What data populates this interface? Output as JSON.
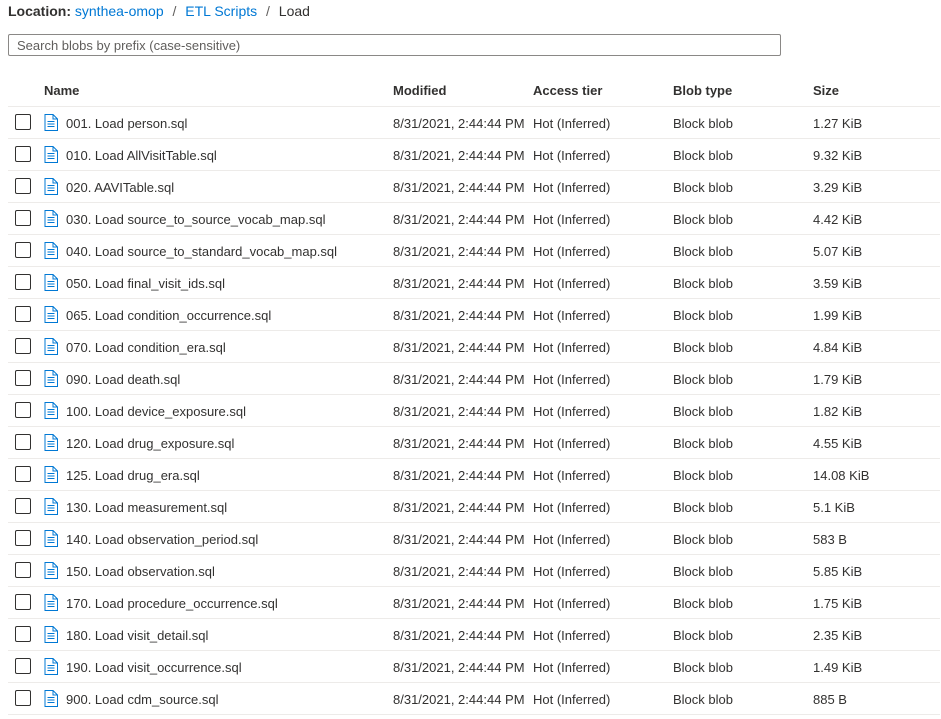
{
  "breadcrumb": {
    "label": "Location:",
    "items": [
      "synthea-omop",
      "ETL Scripts"
    ],
    "current": "Load"
  },
  "search": {
    "placeholder": "Search blobs by prefix (case-sensitive)",
    "value": ""
  },
  "table": {
    "columns": [
      "Name",
      "Modified",
      "Access tier",
      "Blob type",
      "Size"
    ],
    "rows": [
      {
        "name": "001. Load person.sql",
        "modified": "8/31/2021, 2:44:44 PM",
        "tier": "Hot (Inferred)",
        "type": "Block blob",
        "size": "1.27 KiB"
      },
      {
        "name": "010. Load AllVisitTable.sql",
        "modified": "8/31/2021, 2:44:44 PM",
        "tier": "Hot (Inferred)",
        "type": "Block blob",
        "size": "9.32 KiB"
      },
      {
        "name": "020. AAVITable.sql",
        "modified": "8/31/2021, 2:44:44 PM",
        "tier": "Hot (Inferred)",
        "type": "Block blob",
        "size": "3.29 KiB"
      },
      {
        "name": "030. Load source_to_source_vocab_map.sql",
        "modified": "8/31/2021, 2:44:44 PM",
        "tier": "Hot (Inferred)",
        "type": "Block blob",
        "size": "4.42 KiB"
      },
      {
        "name": "040. Load source_to_standard_vocab_map.sql",
        "modified": "8/31/2021, 2:44:44 PM",
        "tier": "Hot (Inferred)",
        "type": "Block blob",
        "size": "5.07 KiB"
      },
      {
        "name": "050. Load final_visit_ids.sql",
        "modified": "8/31/2021, 2:44:44 PM",
        "tier": "Hot (Inferred)",
        "type": "Block blob",
        "size": "3.59 KiB"
      },
      {
        "name": "065. Load condition_occurrence.sql",
        "modified": "8/31/2021, 2:44:44 PM",
        "tier": "Hot (Inferred)",
        "type": "Block blob",
        "size": "1.99 KiB"
      },
      {
        "name": "070. Load condition_era.sql",
        "modified": "8/31/2021, 2:44:44 PM",
        "tier": "Hot (Inferred)",
        "type": "Block blob",
        "size": "4.84 KiB"
      },
      {
        "name": "090. Load death.sql",
        "modified": "8/31/2021, 2:44:44 PM",
        "tier": "Hot (Inferred)",
        "type": "Block blob",
        "size": "1.79 KiB"
      },
      {
        "name": "100. Load device_exposure.sql",
        "modified": "8/31/2021, 2:44:44 PM",
        "tier": "Hot (Inferred)",
        "type": "Block blob",
        "size": "1.82 KiB"
      },
      {
        "name": "120. Load drug_exposure.sql",
        "modified": "8/31/2021, 2:44:44 PM",
        "tier": "Hot (Inferred)",
        "type": "Block blob",
        "size": "4.55 KiB"
      },
      {
        "name": "125. Load drug_era.sql",
        "modified": "8/31/2021, 2:44:44 PM",
        "tier": "Hot (Inferred)",
        "type": "Block blob",
        "size": "14.08 KiB"
      },
      {
        "name": "130. Load measurement.sql",
        "modified": "8/31/2021, 2:44:44 PM",
        "tier": "Hot (Inferred)",
        "type": "Block blob",
        "size": "5.1 KiB"
      },
      {
        "name": "140. Load observation_period.sql",
        "modified": "8/31/2021, 2:44:44 PM",
        "tier": "Hot (Inferred)",
        "type": "Block blob",
        "size": "583 B"
      },
      {
        "name": "150. Load observation.sql",
        "modified": "8/31/2021, 2:44:44 PM",
        "tier": "Hot (Inferred)",
        "type": "Block blob",
        "size": "5.85 KiB"
      },
      {
        "name": "170. Load procedure_occurrence.sql",
        "modified": "8/31/2021, 2:44:44 PM",
        "tier": "Hot (Inferred)",
        "type": "Block blob",
        "size": "1.75 KiB"
      },
      {
        "name": "180. Load visit_detail.sql",
        "modified": "8/31/2021, 2:44:44 PM",
        "tier": "Hot (Inferred)",
        "type": "Block blob",
        "size": "2.35 KiB"
      },
      {
        "name": "190. Load visit_occurrence.sql",
        "modified": "8/31/2021, 2:44:44 PM",
        "tier": "Hot (Inferred)",
        "type": "Block blob",
        "size": "1.49 KiB"
      },
      {
        "name": "900. Load cdm_source.sql",
        "modified": "8/31/2021, 2:44:44 PM",
        "tier": "Hot (Inferred)",
        "type": "Block blob",
        "size": "885 B"
      }
    ]
  },
  "colors": {
    "link": "#0078d4",
    "text": "#323130",
    "icon_blue": "#0078d4",
    "divider": "#edebe9"
  },
  "icons": {
    "file": "document-icon"
  }
}
